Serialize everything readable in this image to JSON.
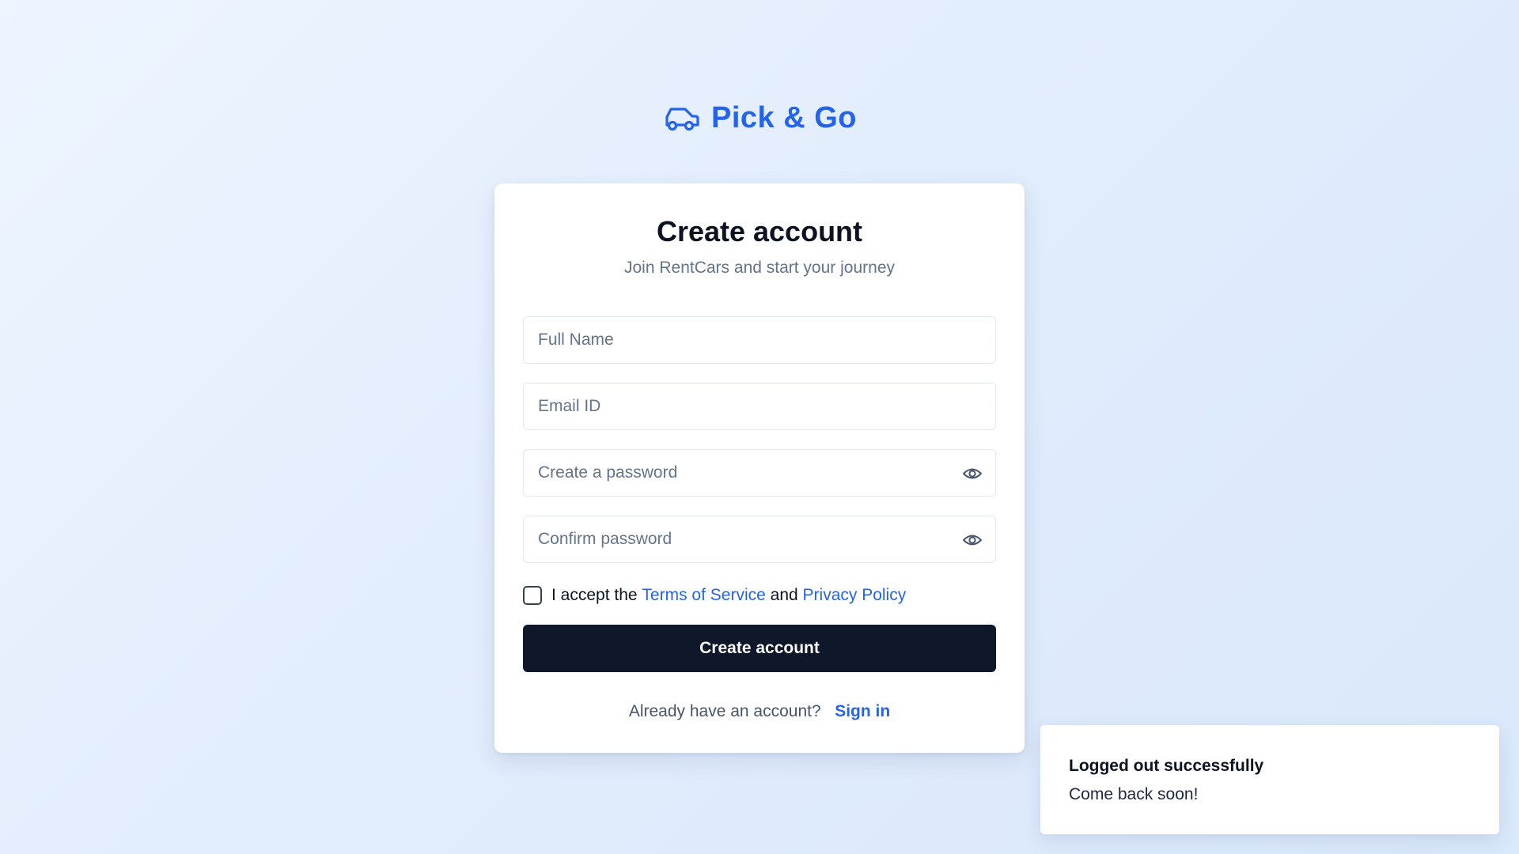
{
  "brand": {
    "name": "Pick & Go",
    "icon": "car-icon",
    "color": "#2563eb"
  },
  "card": {
    "title": "Create account",
    "subtitle": "Join RentCars and start your journey"
  },
  "form": {
    "full_name": {
      "placeholder": "Full Name",
      "value": ""
    },
    "email": {
      "placeholder": "Email ID",
      "value": ""
    },
    "password": {
      "placeholder": "Create a password",
      "value": "",
      "icon": "eye-icon"
    },
    "confirm_password": {
      "placeholder": "Confirm password",
      "value": "",
      "icon": "eye-icon"
    },
    "terms": {
      "checked": false,
      "prefix": "I accept the",
      "tos_link": "Terms of Service",
      "connector": "and",
      "privacy_link": "Privacy Policy"
    },
    "submit_label": "Create account"
  },
  "footer": {
    "prompt": "Already have an account?",
    "signin_link": "Sign in"
  },
  "toast": {
    "title": "Logged out successfully",
    "description": "Come back soon!"
  },
  "colors": {
    "accent": "#2563eb",
    "button_bg": "#0f172a",
    "muted_text": "#64748b"
  }
}
